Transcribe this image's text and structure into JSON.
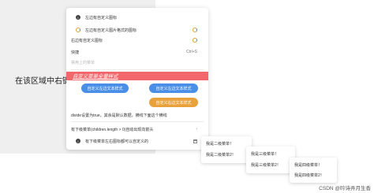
{
  "area": {
    "text": "在该区域中右键鼠标,"
  },
  "menu": {
    "items": [
      {
        "label": "左边有自定义图标"
      },
      {
        "label": "左边有自定义图片格式的图标"
      },
      {
        "label": "右边有自定义图标"
      },
      {
        "label": "快捷",
        "shortcut": "Ctrl+S"
      },
      {
        "label": "禁用上的菜单"
      }
    ],
    "styled_label": "自定义菜单全量样式",
    "buttons": [
      "自定义左边文本样式",
      "自定义左边文本样式",
      "自定义右边文本样式"
    ],
    "divider_note": "divide设置为true，其余是默认数据，横线下面这个横线",
    "children_item": "有下级菜单(children.length > 0)自动出现向箭头",
    "last_item": "有下级菜单左右图标都可以自定义的"
  },
  "submenus": [
    {
      "items": [
        "我是二级菜单！",
        "我是二级菜单2！"
      ]
    },
    {
      "items": [
        "我是三级菜单！",
        "我是三级菜单2！"
      ]
    },
    {
      "items": [
        "我是四级菜单！",
        "我是四级菜单2！"
      ]
    }
  ],
  "watermark": "CSDN @吟诗弄月生香"
}
